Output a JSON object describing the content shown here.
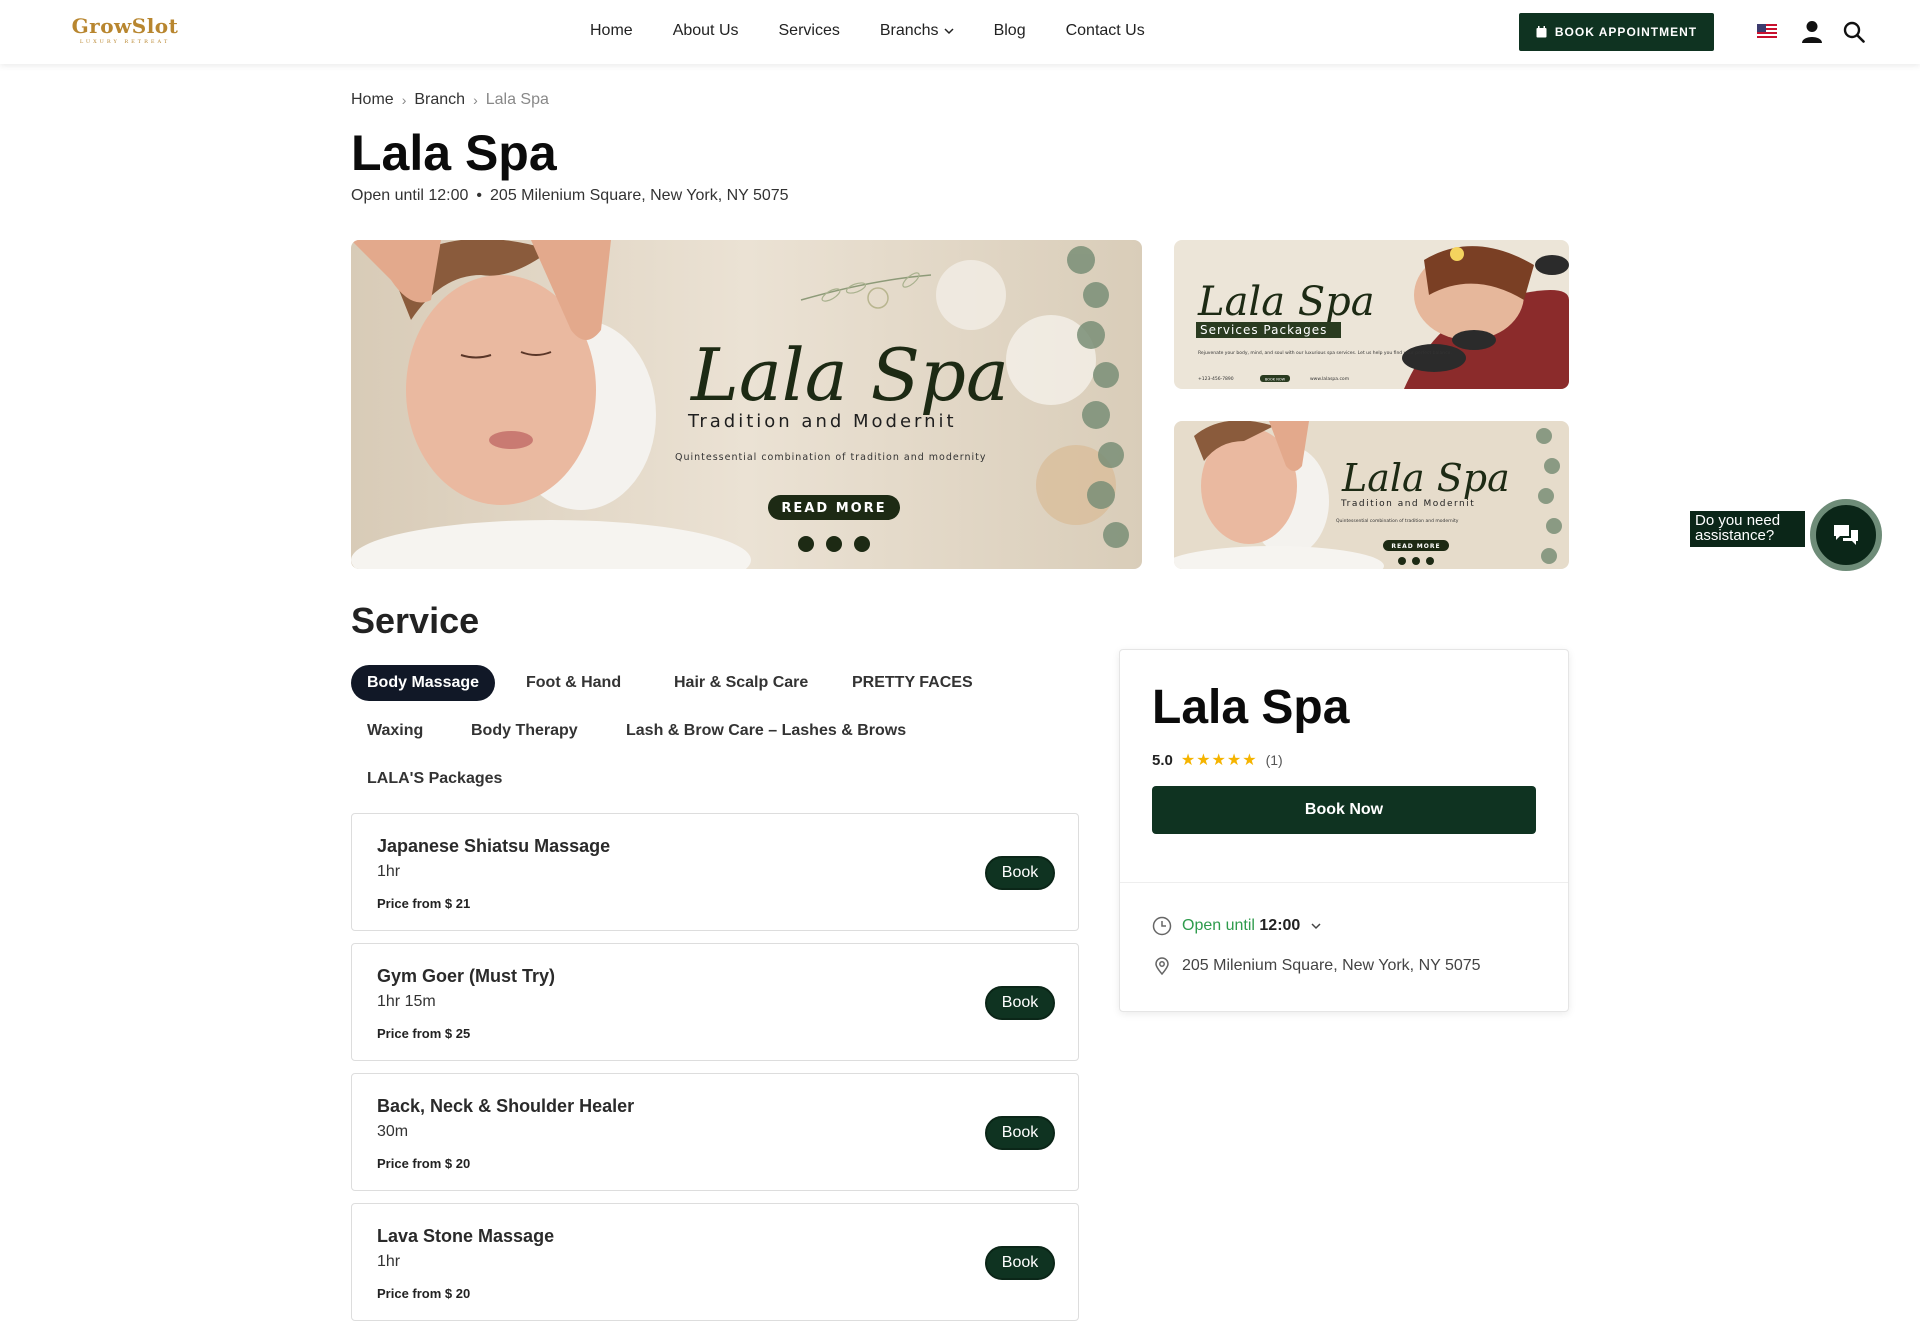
{
  "header": {
    "logo_main": "GrowSlot",
    "logo_sub": "LUXURY RETREAT",
    "nav": [
      "Home",
      "About Us",
      "Services",
      "Branchs",
      "Blog",
      "Contact Us"
    ],
    "book_appointment": "BOOK APPOINTMENT"
  },
  "breadcrumb": [
    "Home",
    "Branch",
    "Lala Spa"
  ],
  "page": {
    "title": "Lala Spa",
    "open_until": "Open until 12:00",
    "bullet": "•",
    "address": "205 Milenium Square, New York, NY 5075"
  },
  "hero": {
    "script_title": "Lala Spa",
    "tagline": "Tradition and Modernit",
    "subtagline": "Quintessential combination of tradition and modernity",
    "cta": "READ MORE"
  },
  "thumb1": {
    "script_title": "Lala Spa",
    "banner": "Services Packages",
    "body": "Rejuvenate your body, mind, and soul with our luxurious spa services. Let us help you find your perfect balance.",
    "phone": "+123-456-7890",
    "cta": "BOOK NOW",
    "site": "www.lalaspa.com"
  },
  "thumb2": {
    "script_title": "Lala Spa",
    "tagline": "Tradition and Modernit",
    "subtagline": "Quintessential combination of tradition and modernity",
    "cta": "READ MORE"
  },
  "service": {
    "title": "Service",
    "tabs": [
      "Body Massage",
      "Foot & Hand",
      "Hair & Scalp Care",
      "PRETTY FACES",
      "Waxing",
      "Body Therapy",
      "Lash & Brow Care – Lashes & Brows",
      "LALA'S Packages"
    ],
    "active_tab": "Body Massage",
    "items": [
      {
        "name": "Japanese Shiatsu Massage",
        "duration": "1hr",
        "price": "Price from $ 21",
        "book": "Book"
      },
      {
        "name": "Gym Goer (Must Try)",
        "duration": "1hr 15m",
        "price": "Price from $ 25",
        "book": "Book"
      },
      {
        "name": "Back, Neck & Shoulder Healer",
        "duration": "30m",
        "price": "Price from $ 20",
        "book": "Book"
      },
      {
        "name": "Lava Stone Massage",
        "duration": "1hr",
        "price": "Price from $ 20",
        "book": "Book"
      }
    ]
  },
  "side_card": {
    "title": "Lala Spa",
    "rating": "5.0",
    "stars": "★★★★★",
    "rating_count": "(1)",
    "book_now": "Book Now",
    "open_label": "Open until",
    "open_time": "12:00",
    "address": "205 Milenium Square, New York, NY 5075"
  },
  "chat": {
    "label": "Do you need assistance?"
  },
  "colors": {
    "brand_dark": "#0f3321",
    "gold": "#b8862f",
    "open_green": "#2e9b4c",
    "star": "#f5b400"
  }
}
